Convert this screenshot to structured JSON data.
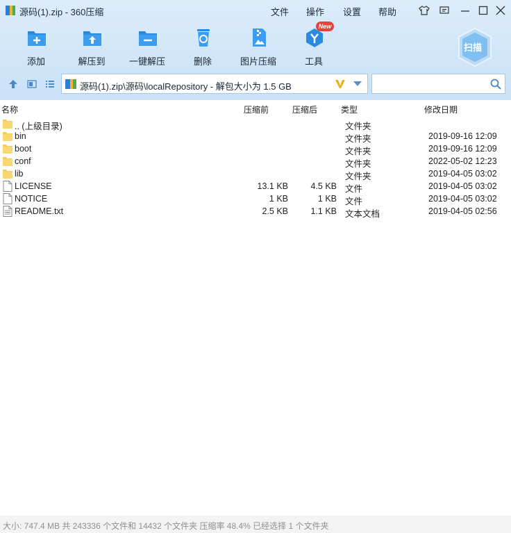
{
  "window": {
    "title": "源码(1).zip - 360压缩"
  },
  "menu": {
    "file": "文件",
    "operate": "操作",
    "settings": "设置",
    "help": "帮助"
  },
  "toolbar": {
    "add": "添加",
    "extract_to": "解压到",
    "one_click": "一键解压",
    "delete": "删除",
    "image_compress": "图片压缩",
    "tools": "工具",
    "tools_badge": "New"
  },
  "scan": {
    "label": "扫描"
  },
  "address": {
    "path": "源码(1).zip\\源码\\localRepository - 解包大小为 1.5 GB"
  },
  "search": {
    "placeholder": "",
    "value": ""
  },
  "columns": {
    "name": "名称",
    "before": "压缩前",
    "after": "压缩后",
    "type": "类型",
    "date": "修改日期"
  },
  "files": [
    {
      "name": ".. (上级目录)",
      "before": "",
      "after": "",
      "type": "文件夹",
      "date": "",
      "icon": "folder"
    },
    {
      "name": "bin",
      "before": "",
      "after": "",
      "type": "文件夹",
      "date": "2019-09-16 12:09",
      "icon": "folder"
    },
    {
      "name": "boot",
      "before": "",
      "after": "",
      "type": "文件夹",
      "date": "2019-09-16 12:09",
      "icon": "folder"
    },
    {
      "name": "conf",
      "before": "",
      "after": "",
      "type": "文件夹",
      "date": "2022-05-02 12:23",
      "icon": "folder"
    },
    {
      "name": "lib",
      "before": "",
      "after": "",
      "type": "文件夹",
      "date": "2019-04-05 03:02",
      "icon": "folder"
    },
    {
      "name": "LICENSE",
      "before": "13.1 KB",
      "after": "4.5 KB",
      "type": "文件",
      "date": "2019-04-05 03:02",
      "icon": "file"
    },
    {
      "name": "NOTICE",
      "before": "1 KB",
      "after": "1 KB",
      "type": "文件",
      "date": "2019-04-05 03:02",
      "icon": "file"
    },
    {
      "name": "README.txt",
      "before": "2.5 KB",
      "after": "1.1 KB",
      "type": "文本文档",
      "date": "2019-04-05 02:56",
      "icon": "text-file"
    }
  ],
  "status": {
    "text": "大小: 747.4 MB 共 243336 个文件和 14432 个文件夹 压缩率 48.4% 已经选择 1 个文件夹"
  },
  "colors": {
    "accent": "#2a8ae0",
    "toolbar_bg": "#d3e7f9",
    "folder": "#f5cc57",
    "new_badge": "#e8413a"
  }
}
